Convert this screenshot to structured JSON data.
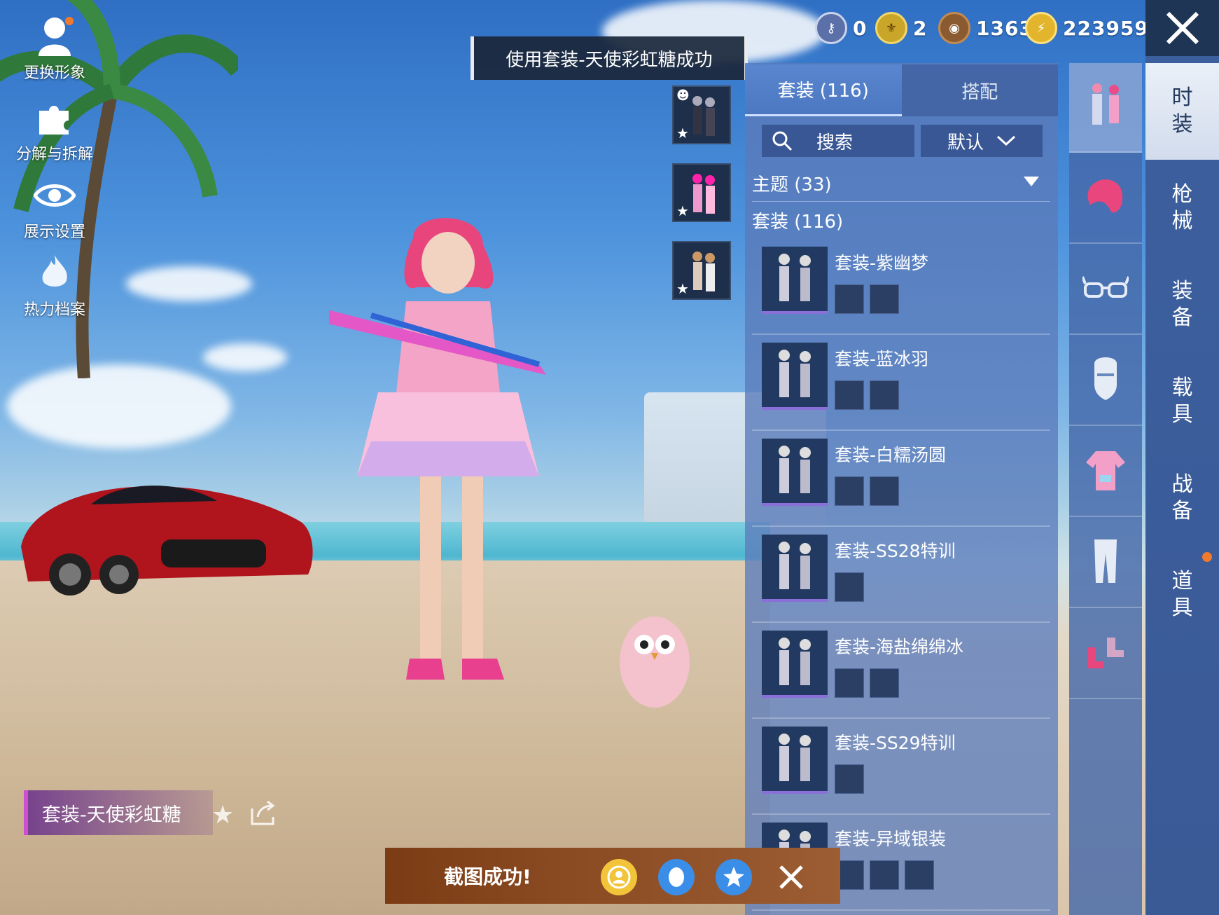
{
  "left_menu": [
    {
      "label": "更换形象",
      "icon": "avatar-icon"
    },
    {
      "label": "分解与拆解",
      "icon": "puzzle-icon"
    },
    {
      "label": "展示设置",
      "icon": "eye-icon"
    },
    {
      "label": "热力档案",
      "icon": "flame-icon"
    }
  ],
  "currencies": [
    {
      "icon": "key-coin-icon",
      "value": "0",
      "color": "#5b6fa8"
    },
    {
      "icon": "gold-badge-icon",
      "value": "2",
      "color": "#c9a52a"
    },
    {
      "icon": "bronze-coin-icon",
      "value": "1363",
      "color": "#8a5a30"
    },
    {
      "icon": "lightning-coin-icon",
      "value": "223959",
      "color": "#e3b52c"
    }
  ],
  "toast": {
    "text": "使用套装-天使彩虹糖成功"
  },
  "tabs": {
    "outfits": "套装 (116)",
    "match": "搭配"
  },
  "search": {
    "label": "搜索",
    "sort": "默认"
  },
  "sections": {
    "theme": "主题 (33)",
    "outfits": "套装 (116)"
  },
  "outfit_list": [
    {
      "name": "套装-紫幽梦",
      "subs": 2
    },
    {
      "name": "套装-蓝冰羽",
      "subs": 2
    },
    {
      "name": "套装-白糯汤圆",
      "subs": 2
    },
    {
      "name": "套装-SS28特训",
      "subs": 1
    },
    {
      "name": "套装-海盐绵绵冰",
      "subs": 2
    },
    {
      "name": "套装-SS29特训",
      "subs": 1
    },
    {
      "name": "套装-异域银装",
      "subs": 3
    }
  ],
  "vertical_tabs": [
    "时装",
    "枪械",
    "装备",
    "载具",
    "战备",
    "道具"
  ],
  "category_icons": [
    "outfit-set-icon",
    "hair-icon",
    "glasses-icon",
    "mask-icon",
    "top-icon",
    "pants-icon",
    "shoes-icon"
  ],
  "current_outfit": {
    "label": "套装-天使彩虹糖"
  },
  "screenshot_bar": {
    "text": "截图成功!"
  },
  "colors": {
    "accent": "#8a6fd8",
    "panel": "#5a80c4",
    "active_tab": "#e6edf7",
    "notification": "#f07a2e"
  }
}
